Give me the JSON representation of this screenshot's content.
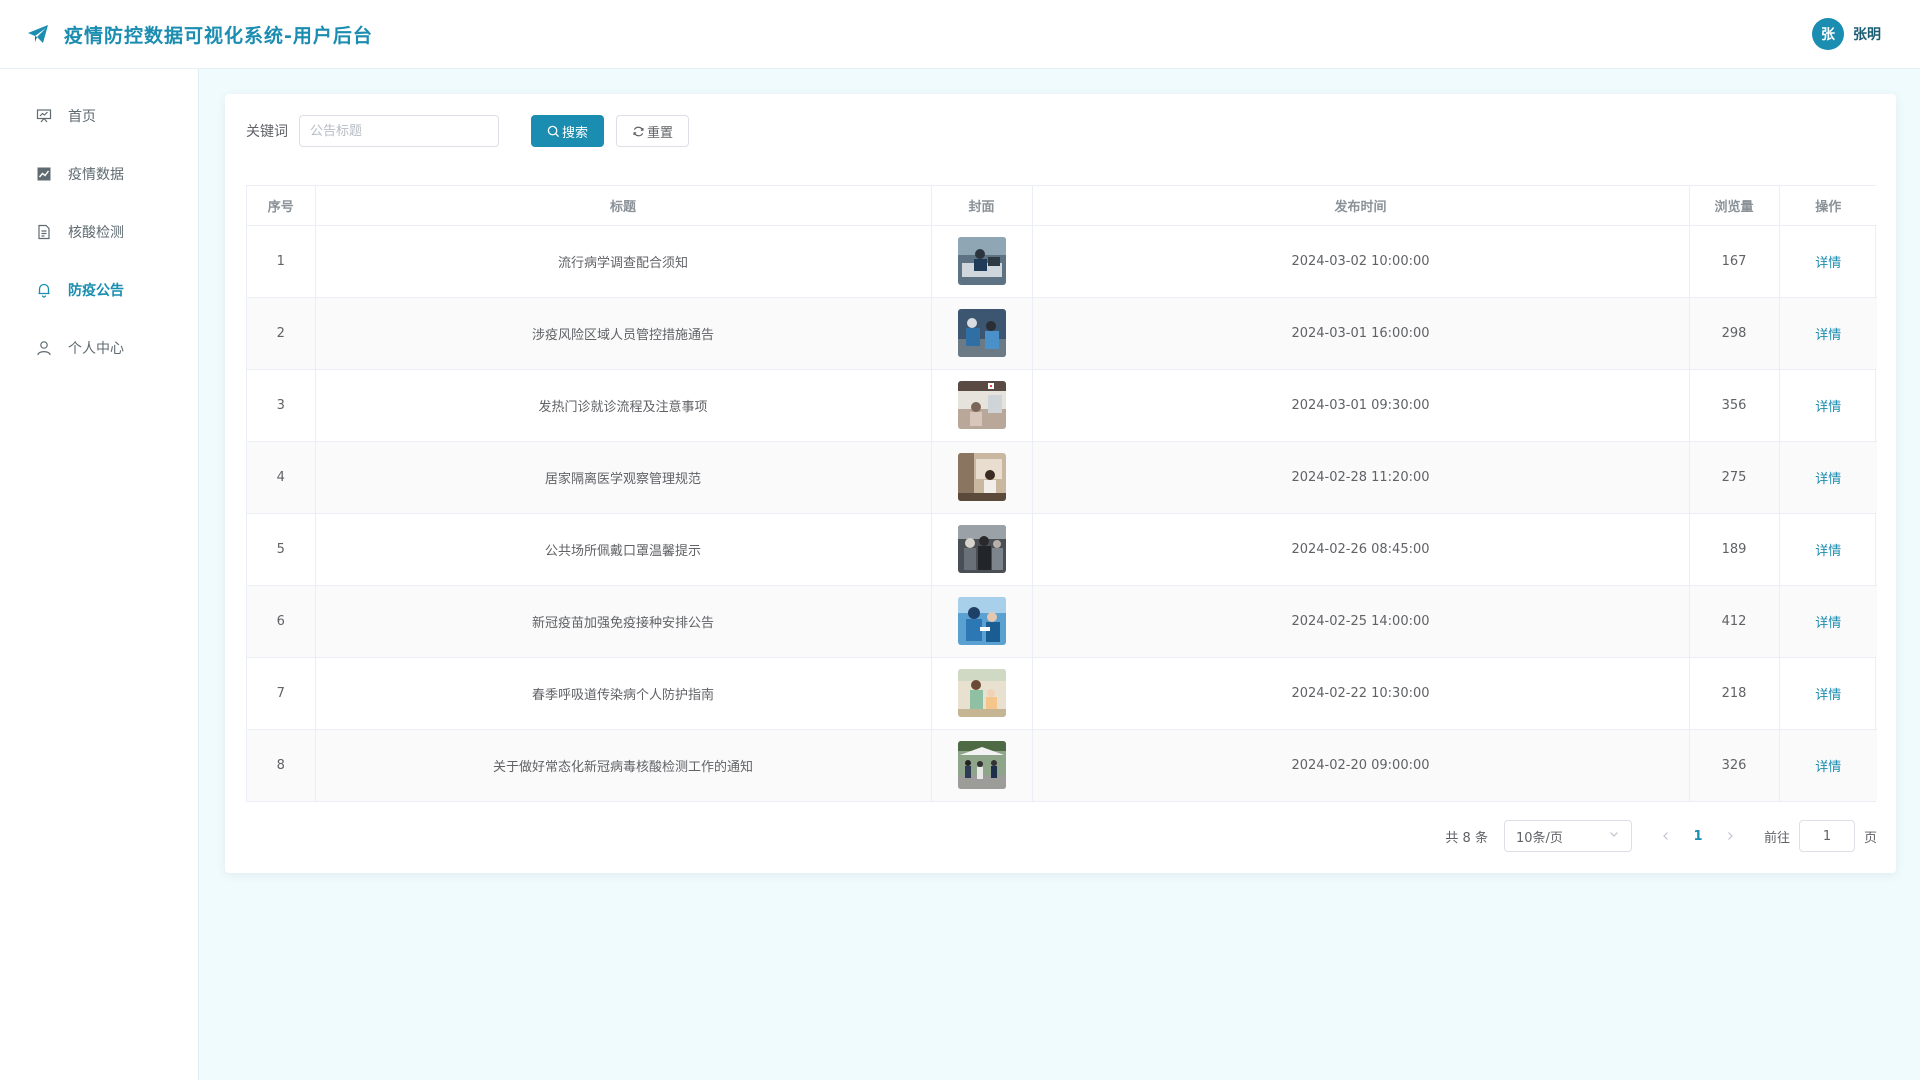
{
  "app": {
    "title": "疫情防控数据可视化系统-用户后台"
  },
  "user": {
    "avatar_initial": "张",
    "name": "张明"
  },
  "colors": {
    "accent": "#1a8db0",
    "background": "#f0fbfd"
  },
  "sidebar": {
    "items": [
      {
        "label": "首页",
        "icon": "presentation-board-icon",
        "active": false
      },
      {
        "label": "疫情数据",
        "icon": "line-chart-icon",
        "active": false
      },
      {
        "label": "核酸检测",
        "icon": "document-icon",
        "active": false
      },
      {
        "label": "防疫公告",
        "icon": "bell-icon",
        "active": true
      },
      {
        "label": "个人中心",
        "icon": "user-icon",
        "active": false
      }
    ]
  },
  "search": {
    "label": "关键词",
    "placeholder": "公告标题",
    "value": "",
    "search_button": "搜索",
    "reset_button": "重置"
  },
  "table": {
    "columns": [
      "序号",
      "标题",
      "封面",
      "发布时间",
      "浏览量",
      "操作"
    ],
    "rows": [
      {
        "index": "1",
        "title": "流行病学调查配合须知",
        "cover": "photo-epidemiology",
        "time": "2024-03-02 10:00:00",
        "views": "167",
        "action": "详情"
      },
      {
        "index": "2",
        "title": "涉疫风险区域人员管控措施通告",
        "cover": "photo-risk-control",
        "time": "2024-03-01 16:00:00",
        "views": "298",
        "action": "详情"
      },
      {
        "index": "3",
        "title": "发热门诊就诊流程及注意事项",
        "cover": "photo-fever-clinic",
        "time": "2024-03-01 09:30:00",
        "views": "356",
        "action": "详情"
      },
      {
        "index": "4",
        "title": "居家隔离医学观察管理规范",
        "cover": "photo-home-isolation",
        "time": "2024-02-28 11:20:00",
        "views": "275",
        "action": "详情"
      },
      {
        "index": "5",
        "title": "公共场所佩戴口罩温馨提示",
        "cover": "photo-mask-public",
        "time": "2024-02-26 08:45:00",
        "views": "189",
        "action": "详情"
      },
      {
        "index": "6",
        "title": "新冠疫苗加强免疫接种安排公告",
        "cover": "photo-vaccination",
        "time": "2024-02-25 14:00:00",
        "views": "412",
        "action": "详情"
      },
      {
        "index": "7",
        "title": "春季呼吸道传染病个人防护指南",
        "cover": "photo-respiratory",
        "time": "2024-02-22 10:30:00",
        "views": "218",
        "action": "详情"
      },
      {
        "index": "8",
        "title": "关于做好常态化新冠病毒核酸检测工作的通知",
        "cover": "photo-nucleic-test",
        "time": "2024-02-20 09:00:00",
        "views": "326",
        "action": "详情"
      }
    ]
  },
  "pagination": {
    "total_text": "共 8 条",
    "page_size": "10条/页",
    "current_page": "1",
    "goto_label": "前往",
    "goto_value": "1",
    "page_unit": "页"
  }
}
